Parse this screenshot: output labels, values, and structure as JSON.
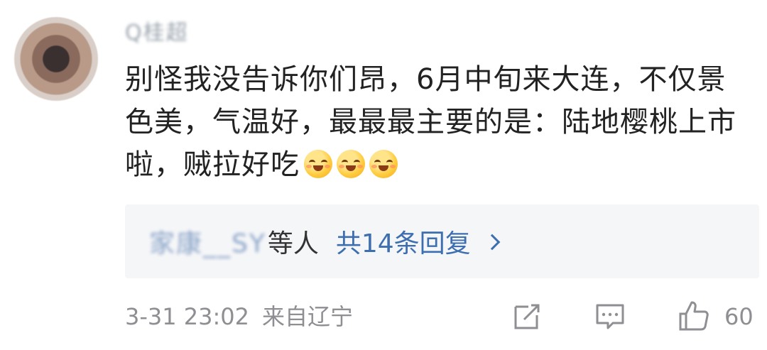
{
  "comment": {
    "username": "Q桂超",
    "text": "别怪我没告诉你们昂，6月中旬来大连，不仅景色美，气温好，最最最主要的是：陆地樱桃上市啦，贼拉好吃",
    "emoji": [
      "blush-emoji",
      "blush-emoji",
      "blush-emoji"
    ],
    "replies": {
      "names": "家康__SY",
      "suffix": "等人",
      "count_label": "共14条回复"
    },
    "time": "3-31 23:02",
    "location": "来自辽宁",
    "likes": "60"
  },
  "icons": {
    "share": "share-icon",
    "comment": "comment-icon",
    "like": "thumbs-up-icon"
  },
  "colors": {
    "link": "#3d6fb0",
    "meta": "#8e8e93",
    "reply_bg": "#f5f6f8"
  }
}
